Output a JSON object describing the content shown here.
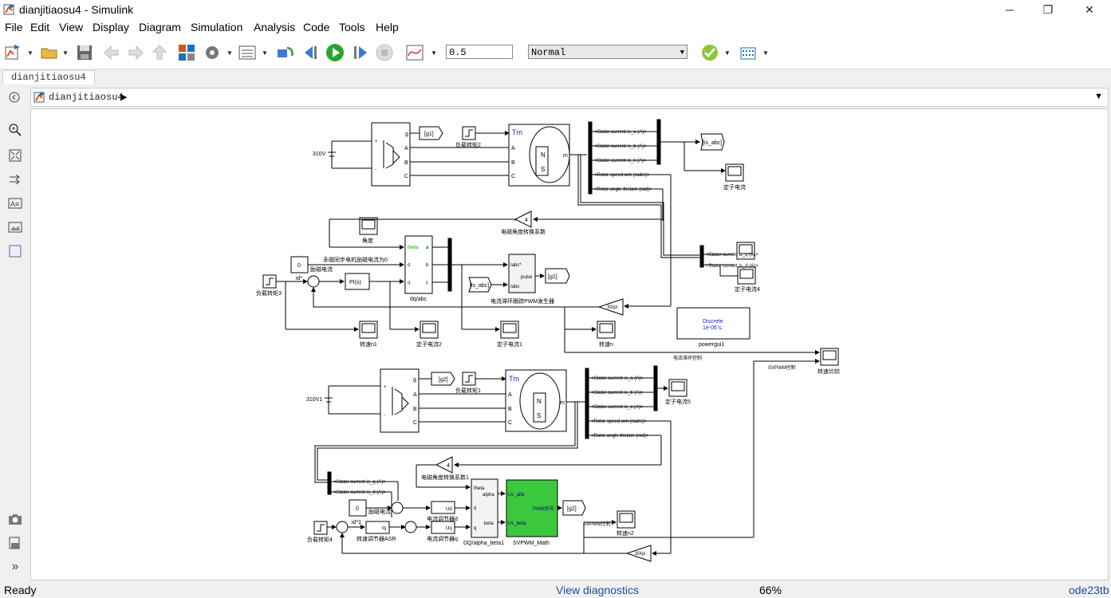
{
  "window": {
    "title": "dianjitiaosu4 - Simulink",
    "minimize": "─",
    "maximize": "❐",
    "close": "✕"
  },
  "menu": [
    "File",
    "Edit",
    "View",
    "Display",
    "Diagram",
    "Simulation",
    "Analysis",
    "Code",
    "Tools",
    "Help"
  ],
  "toolbar": {
    "stop_time": "0.5",
    "sim_mode": "Normal",
    "icons": [
      "new-model-icon",
      "open-icon",
      "save-icon",
      "back-icon",
      "forward-icon",
      "up-icon",
      "library-browser-icon",
      "model-config-icon",
      "model-explorer-icon",
      "step-back-icon",
      "run-icon",
      "step-forward-icon",
      "stop-icon",
      "scope-icon",
      "check-icon",
      "build-icon"
    ]
  },
  "tab": {
    "label": "dianjitiaosu4"
  },
  "address": {
    "path": "dianjitiaosu4"
  },
  "status": {
    "left": "Ready",
    "center": "View diagnostics",
    "zoom": "66%",
    "solver": "ode23tb"
  },
  "diagram": {
    "dc_top": "310V",
    "dc_bottom": "310V1",
    "goto_g1": "[g1]",
    "goto_g1b": "[g1]",
    "goto_g2": "[g2]",
    "goto_g2b": "[g2]",
    "goto_isabc": "[is_abc]",
    "from_isabc": "[is_abc]",
    "tm": "Tm",
    "tm2": "Tm",
    "port_m": "m",
    "port_m2": "m",
    "port_A": "A",
    "port_B": "B",
    "port_C": "C",
    "port_g": "g",
    "step_load2": "负载转矩2",
    "step_load1": "负载转矩1",
    "step_load3": "负载转矩3",
    "step_load4": "负载转矩4",
    "sig_isa": "<Stator current is_a (A)>",
    "sig_isb": "<Stator current is_b (A)>",
    "sig_isc": "<Stator current is_c (A)>",
    "sig_wm": "<Rotor speed wm (rad/s)>",
    "sig_theta": "<Rotor angle thetam (rad)>",
    "sig_isq": "<Stator current is_q (A)>",
    "sig_isd": "<Stator current is_d (A)>",
    "scope_stator": "定子电流",
    "scope_stator4": "定子电流4",
    "scope_stator5": "定子电流5",
    "scope_stator2": "定子电流2",
    "scope_stator1": "定子电流1",
    "scope_angle": "角度",
    "gain4": "4",
    "gain4b": "4",
    "gain_conv": "电磁角度转换系数",
    "gain_conv1": "电磁角度转换系数1",
    "gain_30pi": "30/pi",
    "gain_30pi2": "30/pi",
    "const0": "0",
    "const0b": "0",
    "const_label": "永磁同步电机励磁电流为0",
    "flux_label": "励磁电流",
    "flux_label2": "励磁电流",
    "id_star": "id*",
    "id_star1": "id*1",
    "pi_label": "PI(s)",
    "dqabc_label": "dq/abc",
    "dq_theta": "theta",
    "dq_d": "d",
    "dq_q": "q",
    "dq_a": "a",
    "dq_b": "b",
    "dq_c": "c",
    "pwm_iabc_star": "Iabc*",
    "pwm_pulse": "pulse",
    "pwm_iabc": "Iabc",
    "pwm_label": "电流滞环跟踪PWM发生器",
    "speed_n1": "转速n1",
    "speed_n": "转速n",
    "speed_n2": "转速n2",
    "speed_cmp": "转速比较",
    "powergui_mode": "Discrete",
    "powergui_ts": "1e-06 s.",
    "powergui_label": "powergui1",
    "hysteresis_label": "电流滞环控制",
    "svpwm_ctrl": "SVPWM控制",
    "svpwm_ctrl2": "SVPWM控制",
    "ud": "Ud",
    "uq": "Uq",
    "iq": "Iq",
    "cur_reg_d": "电流调节器d",
    "cur_reg_q": "电流调节器q",
    "speed_reg": "转速调节器ASR",
    "dqab_theta": "theta",
    "dqab_alpha": "alpha",
    "dqab_beta": "beta",
    "dqab_d": "d",
    "dqab_q": "q",
    "dqab_label": "DQ/alpha_beta1",
    "svpwm_in1": "Us_alfa",
    "svpwm_in2": "Us_beta",
    "svpwm_out": "PWM信号",
    "svpwm_label": "SVPWM_Math",
    "plus": "+",
    "minus": "-"
  }
}
